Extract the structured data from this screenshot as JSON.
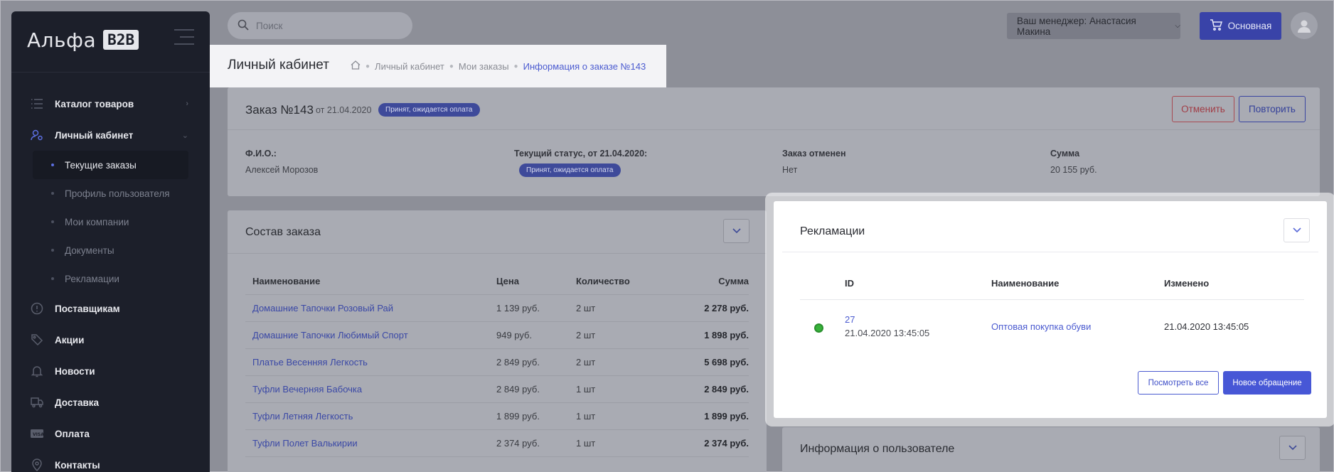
{
  "sidebar": {
    "logo_text": "Альфа",
    "logo_badge": "B2B",
    "items": [
      {
        "label": "Каталог товаров",
        "icon": "list-icon"
      },
      {
        "label": "Личный кабинет",
        "icon": "user-settings-icon"
      },
      {
        "label": "Поставщикам",
        "icon": "info-circle-icon"
      },
      {
        "label": "Акции",
        "icon": "tag-icon"
      },
      {
        "label": "Новости",
        "icon": "bell-icon"
      },
      {
        "label": "Доставка",
        "icon": "truck-icon"
      },
      {
        "label": "Оплата",
        "icon": "card-icon"
      },
      {
        "label": "Контакты",
        "icon": "location-icon"
      }
    ],
    "subitems": [
      "Текущие заказы",
      "Профиль пользователя",
      "Мои компании",
      "Документы",
      "Рекламации"
    ]
  },
  "topbar": {
    "search_placeholder": "Поиск",
    "manager_label": "Ваш менеджер: Анастасия Макина",
    "main_button": "Основная"
  },
  "header": {
    "title": "Личный кабинет",
    "breadcrumbs": [
      "Личный кабинет",
      "Мои заказы",
      "Информация о заказе №143"
    ]
  },
  "order": {
    "title": "Заказ №143",
    "date": "от 21.04.2020",
    "badge": "Принят, ожидается оплата",
    "cancel_button": "Отменить",
    "repeat_button": "Повторить",
    "fields": [
      {
        "label": "Ф.И.О.:",
        "value": "Алексей Морозов"
      },
      {
        "label": "Текущий статус, от 21.04.2020:",
        "value": "Принят, ожидается оплата"
      },
      {
        "label": "Заказ отменен",
        "value": "Нет"
      },
      {
        "label": "Сумма",
        "value": "20 155 руб."
      }
    ]
  },
  "composition": {
    "title": "Состав заказа",
    "columns": [
      "Наименование",
      "Цена",
      "Количество",
      "Сумма"
    ],
    "rows": [
      {
        "name": "Домашние Тапочки Розовый Рай",
        "price": "1 139 руб.",
        "qty": "2  шт",
        "sum": "2 278 руб."
      },
      {
        "name": "Домашние Тапочки Любимый Спорт",
        "price": "949 руб.",
        "qty": "2  шт",
        "sum": "1 898 руб."
      },
      {
        "name": "Платье Весенняя Легкость",
        "price": "2 849 руб.",
        "qty": "2  шт",
        "sum": "5 698 руб."
      },
      {
        "name": "Туфли Вечерняя Бабочка",
        "price": "2 849 руб.",
        "qty": "1  шт",
        "sum": "2 849 руб."
      },
      {
        "name": "Туфли Летняя Легкость",
        "price": "1 899 руб.",
        "qty": "1  шт",
        "sum": "1 899 руб."
      },
      {
        "name": "Туфли Полет Валькирии",
        "price": "2 374 руб.",
        "qty": "1  шт",
        "sum": "2 374 руб."
      }
    ]
  },
  "reclamations": {
    "title": "Рекламации",
    "columns": [
      "ID",
      "Наименование",
      "Изменено"
    ],
    "row": {
      "id": "27",
      "id_date": "21.04.2020 13:45:05",
      "name": "Оптовая покупка обуви",
      "changed": "21.04.2020 13:45:05",
      "status_color": "#37b23a"
    },
    "view_all_button": "Посмотреть все",
    "new_button": "Новое обращение"
  },
  "user_info": {
    "title": "Информация о пользователе"
  }
}
